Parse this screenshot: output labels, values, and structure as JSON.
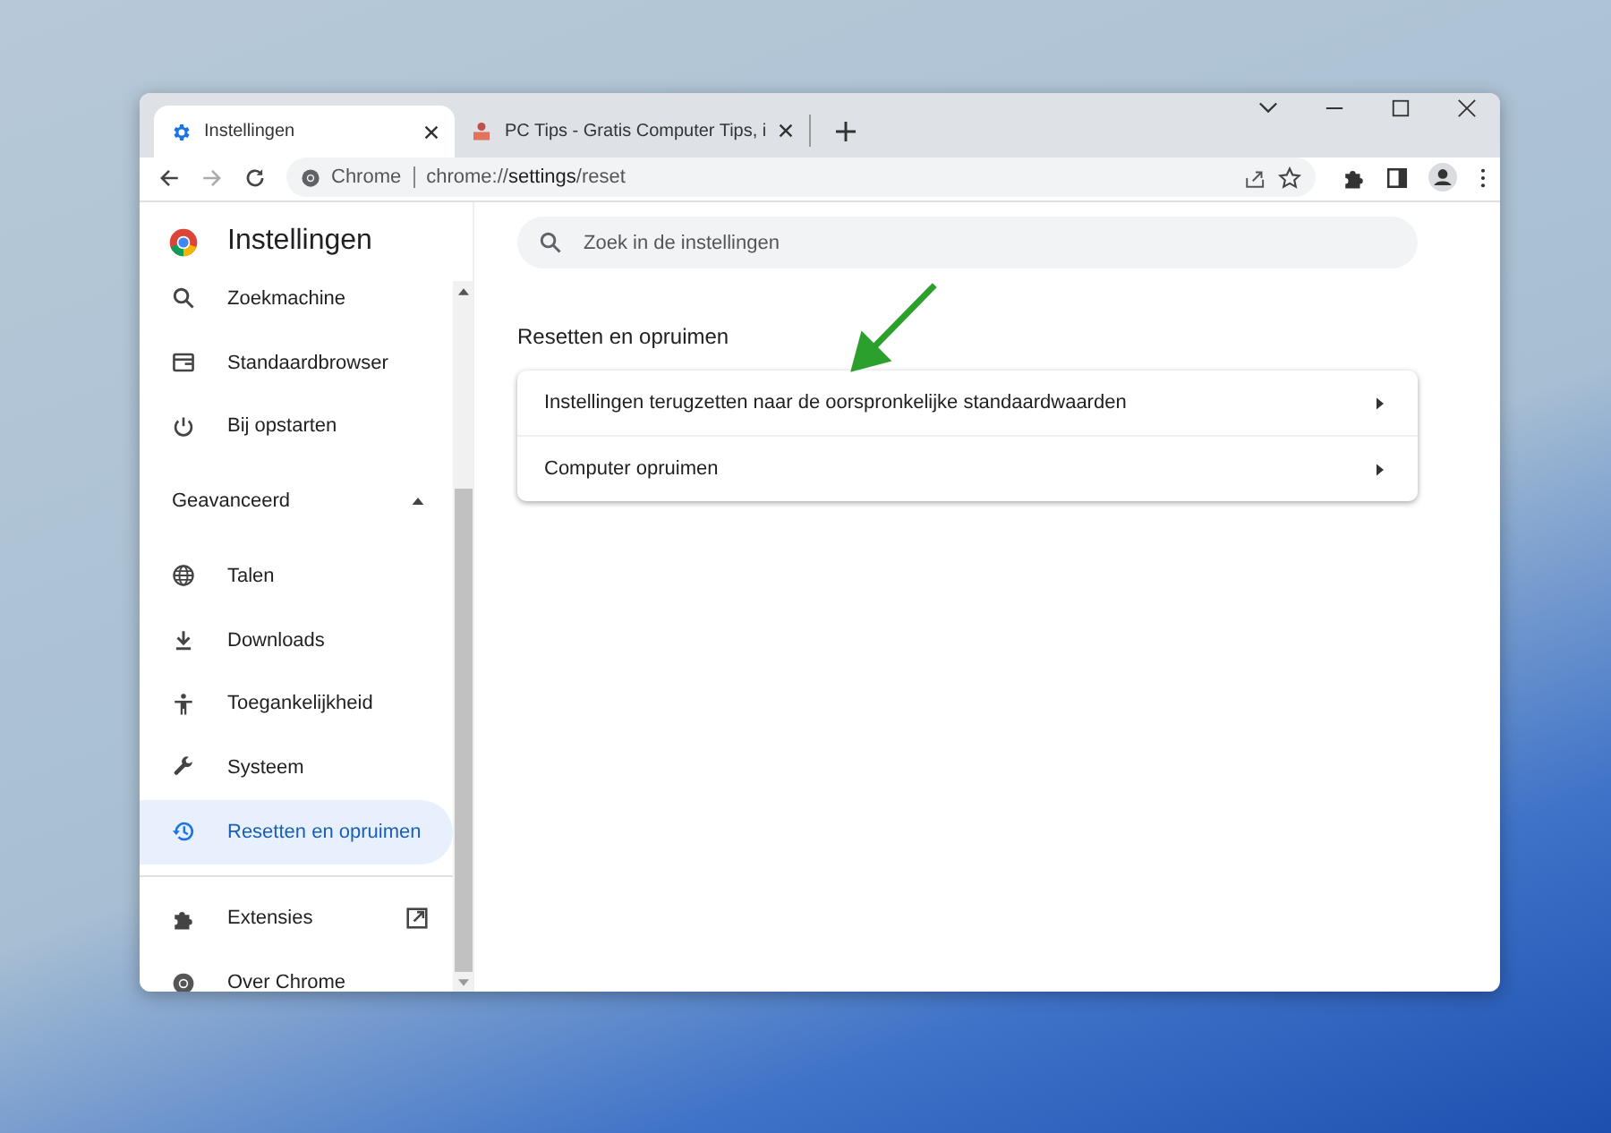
{
  "tabs": [
    {
      "label": "Instellingen",
      "selected": true
    },
    {
      "label": "PC Tips - Gratis Computer Tips, i",
      "selected": false
    }
  ],
  "address_bar": {
    "site_label": "Chrome",
    "url_host": "chrome://",
    "url_path": "settings",
    "url_rest": "/reset"
  },
  "sidebar": {
    "title": "Instellingen",
    "items": [
      {
        "kind": "item",
        "label": "Zoekmachine",
        "selected": false
      },
      {
        "kind": "item",
        "label": "Standaardbrowser",
        "selected": false
      },
      {
        "kind": "item",
        "label": "Bij opstarten",
        "selected": false
      },
      {
        "kind": "section",
        "label": "Geavanceerd",
        "expanded": true
      },
      {
        "kind": "item",
        "label": "Talen",
        "selected": false
      },
      {
        "kind": "item",
        "label": "Downloads",
        "selected": false
      },
      {
        "kind": "item",
        "label": "Toegankelijkheid",
        "selected": false
      },
      {
        "kind": "item",
        "label": "Systeem",
        "selected": false
      },
      {
        "kind": "item",
        "label": "Resetten en opruimen",
        "selected": true
      },
      {
        "kind": "divider"
      },
      {
        "kind": "external",
        "label": "Extensies",
        "selected": false
      },
      {
        "kind": "item",
        "label": "Over Chrome",
        "selected": false
      }
    ]
  },
  "search": {
    "placeholder": "Zoek in de instellingen"
  },
  "section": {
    "title": "Resetten en opruimen",
    "rows": [
      {
        "label": "Instellingen terugzetten naar de oorspronkelijke standaardwaarden"
      },
      {
        "label": "Computer opruimen"
      }
    ]
  }
}
